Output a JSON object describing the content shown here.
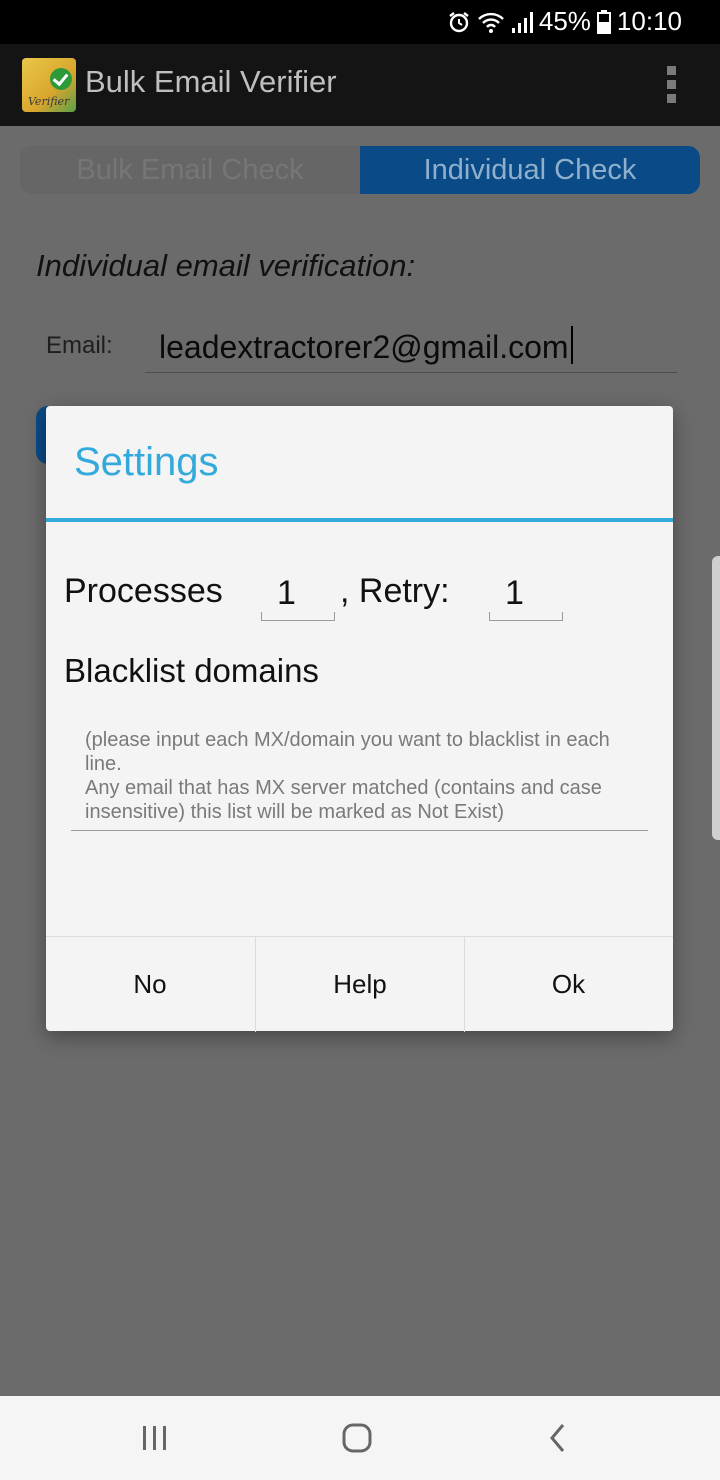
{
  "status_bar": {
    "battery": "45%",
    "time": "10:10",
    "icons": [
      "alarm-icon",
      "wifi-icon",
      "signal-icon",
      "battery-icon"
    ]
  },
  "app_bar": {
    "title": "Bulk Email Verifier",
    "logo_text": "Verifier"
  },
  "tabs": [
    {
      "label": "Bulk Email Check",
      "selected": false
    },
    {
      "label": "Individual Check",
      "selected": true
    }
  ],
  "main": {
    "section_title": "Individual email verification:",
    "email_label": "Email:",
    "email_value": "leadextractorer2@gmail.com"
  },
  "dialog": {
    "title": "Settings",
    "processes_label": "Processes",
    "processes_value": "1",
    "retry_label": ", Retry:",
    "retry_value": "1",
    "blacklist_label": "Blacklist domains",
    "blacklist_placeholder": "(please input each MX/domain you want to blacklist in each line.\nAny email that has MX server matched (contains and case insensitive) this list will be marked as Not Exist)",
    "buttons": {
      "no": "No",
      "help": "Help",
      "ok": "Ok"
    }
  },
  "colors": {
    "accent": "#34aadc",
    "tab_selected": "#0a4a86",
    "dim_overlay": "#6b6b6b"
  }
}
